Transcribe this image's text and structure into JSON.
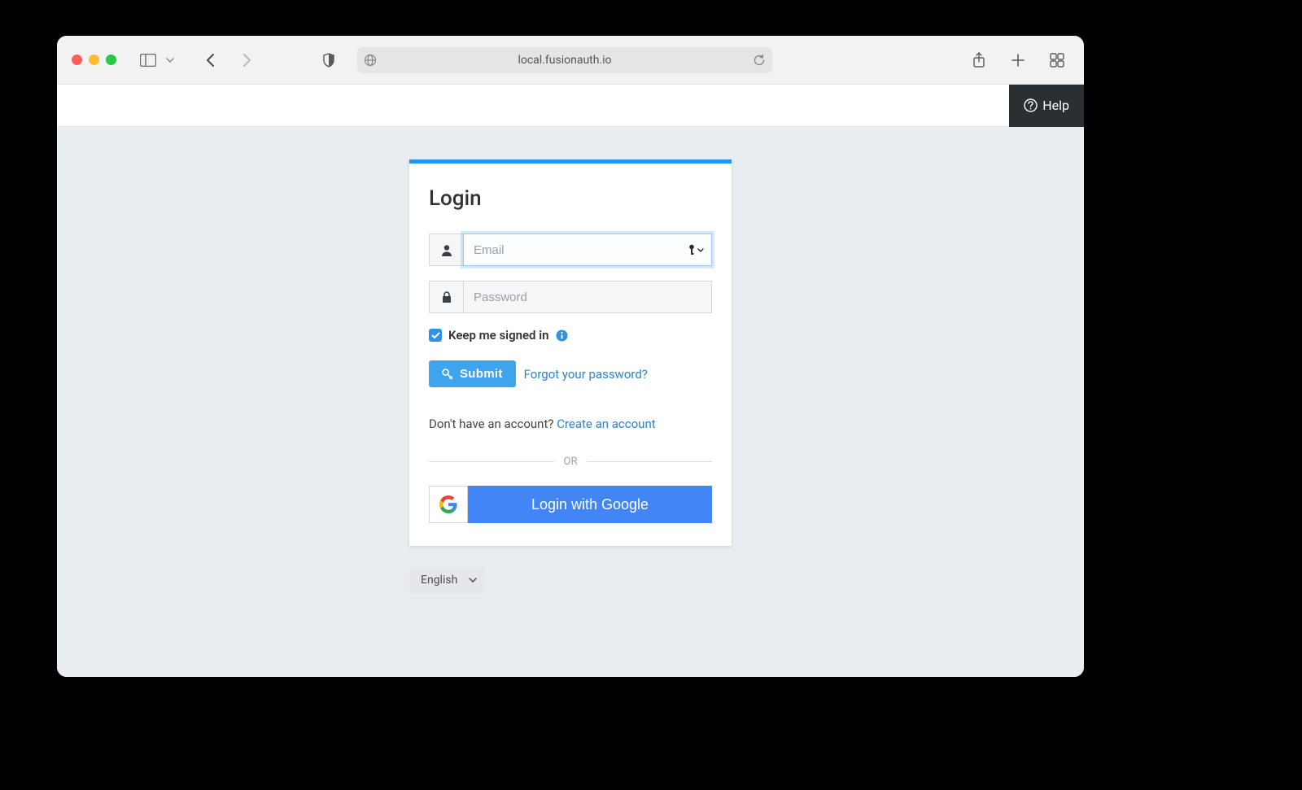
{
  "browser": {
    "url": "local.fusionauth.io"
  },
  "header": {
    "help_label": "Help"
  },
  "login": {
    "title": "Login",
    "email_placeholder": "Email",
    "password_placeholder": "Password",
    "keep_signed_in_label": "Keep me signed in",
    "keep_signed_in_checked": true,
    "submit_label": "Submit",
    "forgot_password_label": "Forgot your password?",
    "no_account_text": "Don't have an account? ",
    "create_account_label": "Create an account",
    "or_divider": "OR",
    "google_login_label": "Login with Google"
  },
  "footer": {
    "language_selected": "English"
  }
}
